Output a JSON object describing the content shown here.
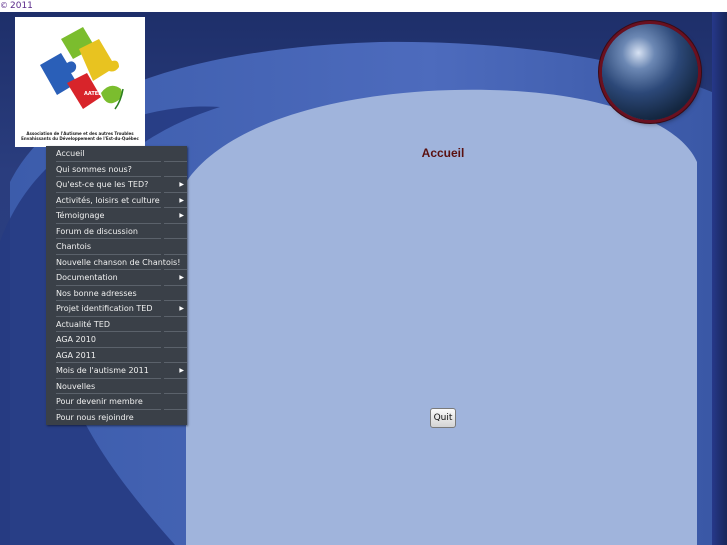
{
  "header": {
    "copyright_symbol": "©",
    "year": "2011"
  },
  "logo": {
    "caption": "Association de l'Autisme et des autres Troubles Envahissants du Développement de l'Est-du-Québec"
  },
  "page": {
    "title": "Accueil"
  },
  "quit": {
    "label": "Quit"
  },
  "colors": {
    "menu_bg": "#3a4048",
    "panel": "#a0b4dc",
    "title": "#5a1010"
  },
  "menu": {
    "items": [
      {
        "label": "Accueil",
        "submenu": false
      },
      {
        "label": "Qui sommes nous?",
        "submenu": false
      },
      {
        "label": "Qu'est-ce que les TED?",
        "submenu": true
      },
      {
        "label": "Activités, loisirs et culture",
        "submenu": true
      },
      {
        "label": "Témoignage",
        "submenu": true
      },
      {
        "label": "Forum de discussion",
        "submenu": false
      },
      {
        "label": "Chantois",
        "submenu": false
      },
      {
        "label": "Nouvelle chanson de Chantois!",
        "submenu": false
      },
      {
        "label": "Documentation",
        "submenu": true
      },
      {
        "label": "Nos bonne adresses",
        "submenu": false
      },
      {
        "label": "Projet identification TED",
        "submenu": true
      },
      {
        "label": "Actualité TED",
        "submenu": false
      },
      {
        "label": "AGA 2010",
        "submenu": false
      },
      {
        "label": "AGA 2011",
        "submenu": false
      },
      {
        "label": "Mois de l'autisme 2011",
        "submenu": true
      },
      {
        "label": "Nouvelles",
        "submenu": false
      },
      {
        "label": "Pour devenir membre",
        "submenu": false
      },
      {
        "label": "Pour nous rejoindre",
        "submenu": false
      }
    ]
  }
}
